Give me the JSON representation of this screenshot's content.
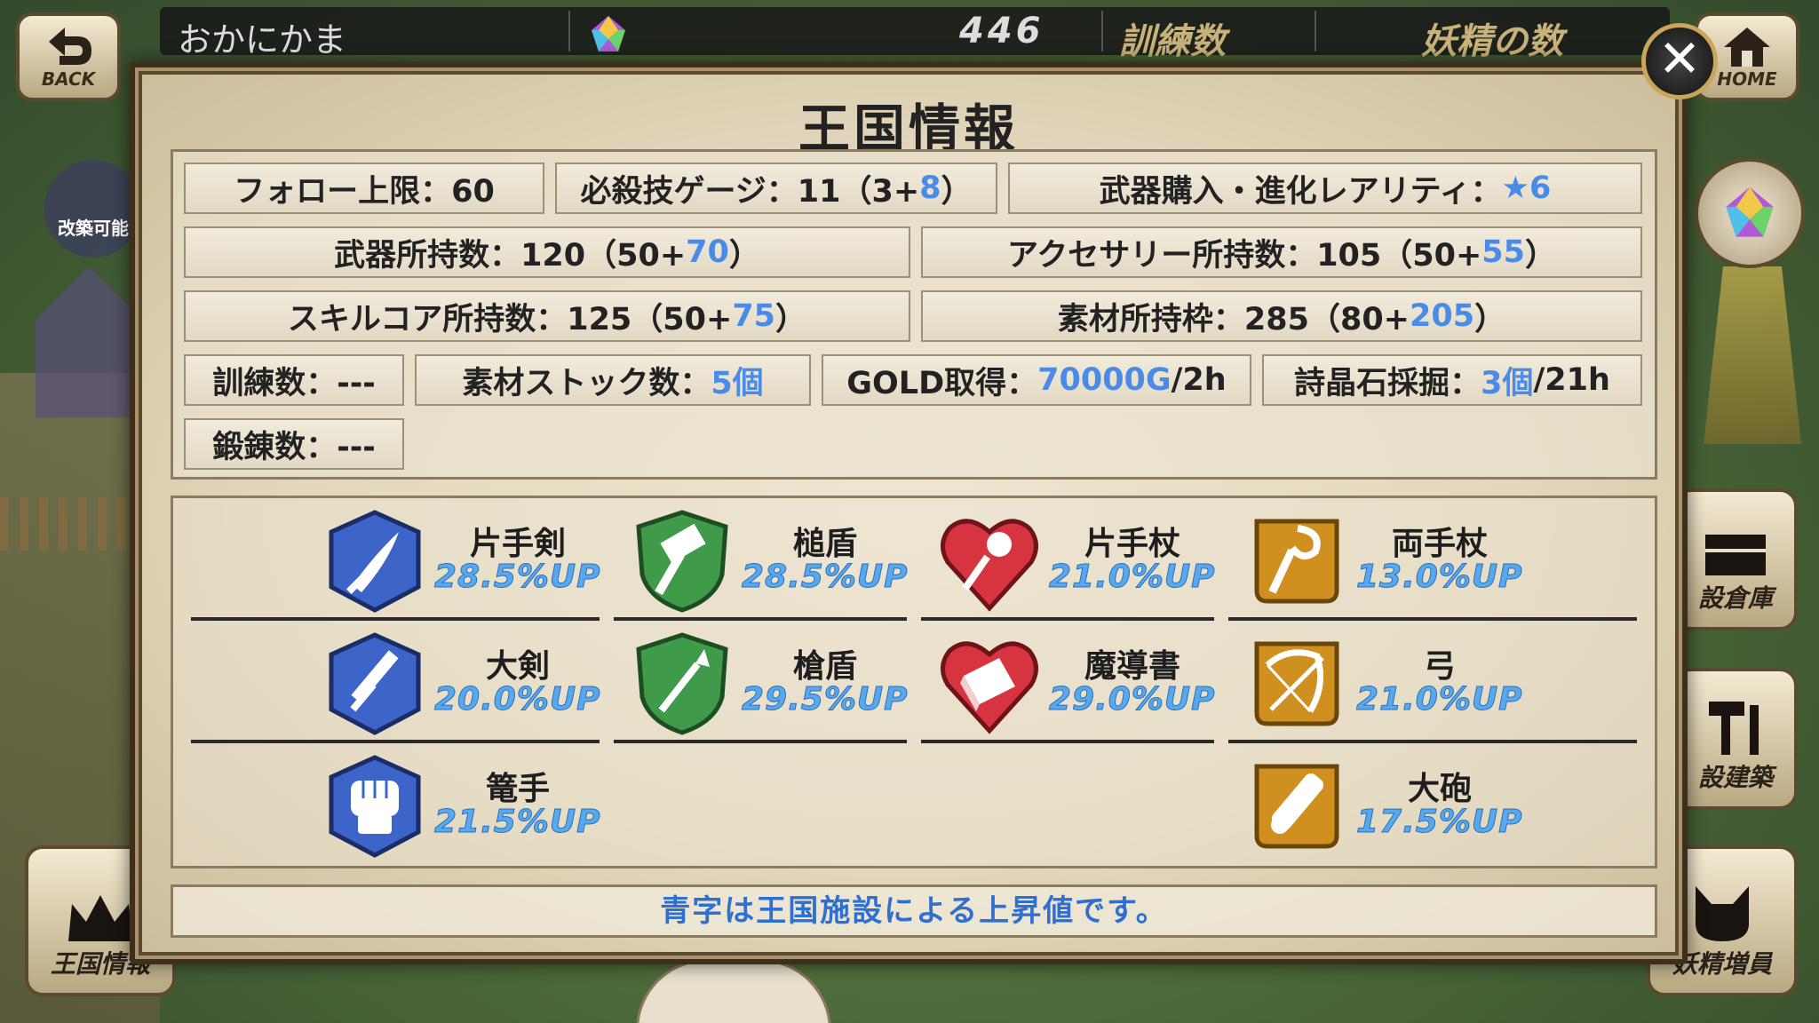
{
  "topbar": {
    "player_name": "おかにかま",
    "currency_count": "446",
    "training_label": "訓練数",
    "fairies_label": "妖精の数"
  },
  "nav": {
    "back_label": "BACK",
    "home_label": "HOME",
    "left_badge": "改築可能",
    "kingdom_info_label": "王国情報",
    "storage_label": "設倉庫",
    "build_label": "設建築",
    "fairy_label": "妖精増員"
  },
  "modal": {
    "title": "王国情報",
    "close_symbol": "✕",
    "stats": {
      "follow_limit": "フォロー上限：60",
      "gauge_prefix": "必殺技ゲージ：11（3+",
      "gauge_bonus": "8",
      "gauge_suffix": "）",
      "rarity_prefix": "武器購入・進化レアリティ：",
      "rarity_bonus": "★6",
      "weapons_prefix": "武器所持数：120（50+",
      "weapons_bonus": "70",
      "weapons_suffix": "）",
      "accessory_prefix": "アクセサリー所持数：105（50+",
      "accessory_bonus": "55",
      "accessory_suffix": "）",
      "skillcore_prefix": "スキルコア所持数：125（50+",
      "skillcore_bonus": "75",
      "skillcore_suffix": "）",
      "material_prefix": "素材所持枠：285（80+",
      "material_bonus": "205",
      "material_suffix": "）",
      "training": "訓練数：---",
      "stock_prefix": "素材ストック数：",
      "stock_bonus": "5個",
      "gold_prefix": "GOLD取得：",
      "gold_bonus": "70000G",
      "gold_suffix": "/2h",
      "gem_prefix": "詩晶石採掘：",
      "gem_bonus": "3個",
      "gem_suffix": "/21h",
      "forging": "鍛錬数：---"
    },
    "weapons": [
      {
        "name": "片手剣",
        "value": "28.5%UP",
        "icon": "one-hand-sword-icon",
        "color": "#3d64c8"
      },
      {
        "name": "槌盾",
        "value": "28.5%UP",
        "icon": "hammer-shield-icon",
        "color": "#3f9a4a"
      },
      {
        "name": "片手杖",
        "value": "21.0%UP",
        "icon": "one-hand-staff-icon",
        "color": "#d6343e"
      },
      {
        "name": "両手杖",
        "value": "13.0%UP",
        "icon": "two-hand-staff-icon",
        "color": "#d09020"
      },
      {
        "name": "大剣",
        "value": "20.0%UP",
        "icon": "great-sword-icon",
        "color": "#3d64c8"
      },
      {
        "name": "槍盾",
        "value": "29.5%UP",
        "icon": "spear-shield-icon",
        "color": "#3f9a4a"
      },
      {
        "name": "魔導書",
        "value": "29.0%UP",
        "icon": "grimoire-icon",
        "color": "#d6343e"
      },
      {
        "name": "弓",
        "value": "21.0%UP",
        "icon": "bow-icon",
        "color": "#d09020"
      },
      {
        "name": "篭手",
        "value": "21.5%UP",
        "icon": "gauntlet-icon",
        "color": "#3d64c8"
      },
      {
        "name": "大砲",
        "value": "17.5%UP",
        "icon": "cannon-icon",
        "color": "#d09020"
      }
    ],
    "footnote": "青字は王国施設による上昇値です。"
  }
}
